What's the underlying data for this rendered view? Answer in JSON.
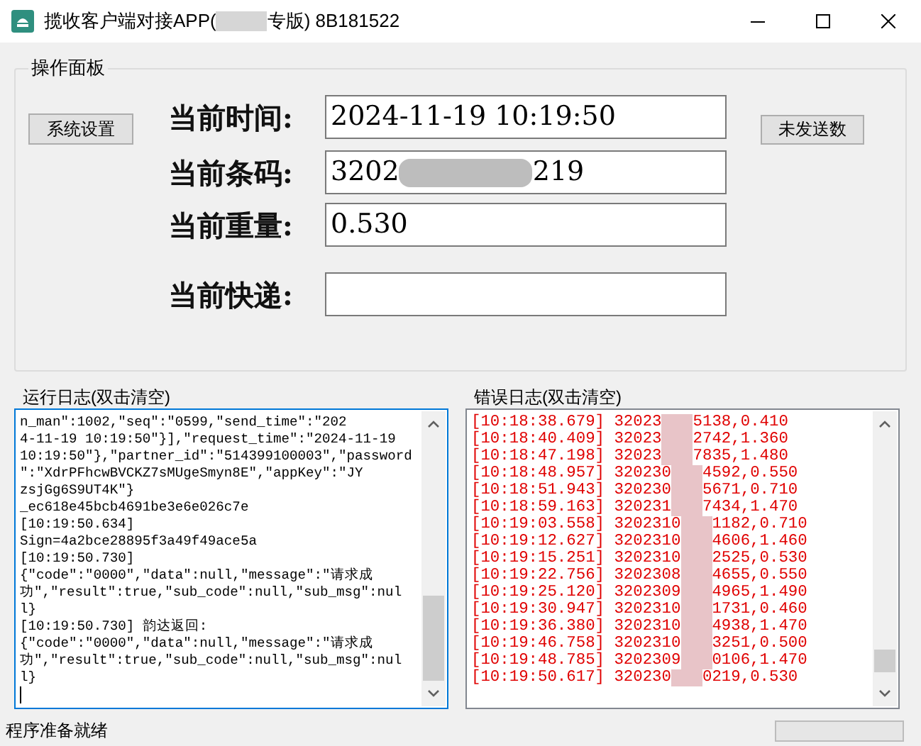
{
  "window": {
    "title_start": "揽收客户端对接APP(",
    "title_end": "专版) 8B181522"
  },
  "panel": {
    "title": "操作面板",
    "left_button": "系统设置",
    "right_button": "未发送数",
    "fields": [
      {
        "label": "当前时间:",
        "value_start": "2024-11-19 10:19:50"
      },
      {
        "label": "当前条码:",
        "value_start": "3202",
        "value_end": "219"
      },
      {
        "label": "当前重量:",
        "value_start": "0.530"
      },
      {
        "label": "当前快递:"
      }
    ]
  },
  "run_log": {
    "title": "运行日志(双击清空)",
    "lines": [
      "n_man\":1002,\"seq\":\"0599,\"send_time\":\"202",
      "4-11-19 10:19:50\"}],\"request_time\":\"2024-11-19",
      "10:19:50\"},\"partner_id\":\"514399100003\",\"password",
      "\":\"XdrPFhcwBVCKZ7sMUgeSmyn8E\",\"appKey\":\"JY",
      "zsjGg6S9UT4K\"}",
      "_ec618e45bcb4691be3e6e026c7e",
      "[10:19:50.634]",
      "Sign=4a2bce28895f3a49f49ace5a",
      "[10:19:50.730]",
      "{\"code\":\"0000\",\"data\":null,\"message\":\"请求成",
      "功\",\"result\":true,\"sub_code\":null,\"sub_msg\":nul",
      "l}",
      "[10:19:50.730] 韵达返回:",
      "{\"code\":\"0000\",\"data\":null,\"message\":\"请求成",
      "功\",\"result\":true,\"sub_code\":null,\"sub_msg\":nul",
      "l}"
    ]
  },
  "error_log": {
    "title": "错误日志(双击清空)",
    "lines": [
      {
        "start": "[10:18:38.679] 32023",
        "end": "5138,0.410"
      },
      {
        "start": "[10:18:40.409] 32023",
        "end": "2742,1.360"
      },
      {
        "start": "[10:18:47.198] 32023",
        "end": "7835,1.480"
      },
      {
        "start": "[10:18:48.957] 320230",
        "end": "4592,0.550"
      },
      {
        "start": "[10:18:51.943] 320230",
        "end": "5671,0.710"
      },
      {
        "start": "[10:18:59.163] 320231",
        "end": "7434,1.470"
      },
      {
        "start": "[10:19:03.558] 3202310",
        "end": "1182,0.710"
      },
      {
        "start": "[10:19:12.627] 3202310",
        "end": "4606,1.460"
      },
      {
        "start": "[10:19:15.251] 3202310",
        "end": "2525,0.530"
      },
      {
        "start": "[10:19:22.756] 3202308",
        "end": "4655,0.550"
      },
      {
        "start": "[10:19:25.120] 3202309",
        "end": "4965,1.490"
      },
      {
        "start": "[10:19:30.947] 3202310",
        "end": "1731,0.460"
      },
      {
        "start": "[10:19:36.380] 3202310",
        "end": "4938,1.470"
      },
      {
        "start": "[10:19:46.758] 3202310",
        "end": "3251,0.500"
      },
      {
        "start": "[10:19:48.785] 3202309",
        "end": "0106,1.470"
      },
      {
        "start": "[10:19:50.617] 320230",
        "end": "0219,0.530"
      }
    ]
  },
  "status_bar": {
    "text": "程序准备就绪",
    "progress": {
      "level": 0
    }
  }
}
